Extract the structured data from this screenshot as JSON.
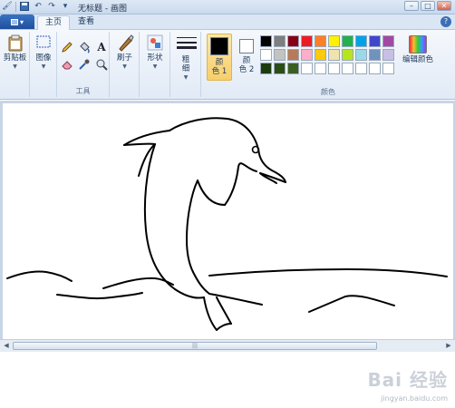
{
  "window": {
    "title": "无标题 - 画图",
    "controls": [
      "minimize-icon",
      "maximize-icon",
      "close-icon"
    ]
  },
  "qat": [
    "save-icon",
    "undo-icon",
    "redo-icon",
    "dropdown-icon"
  ],
  "tabs": [
    {
      "label": "主页",
      "active": true
    },
    {
      "label": "查看",
      "active": false
    }
  ],
  "ribbon": {
    "clipboard": {
      "label": "剪贴板"
    },
    "image": {
      "label": "图像"
    },
    "tools": {
      "group_label": "工具",
      "items": [
        "pencil-icon",
        "fill-icon",
        "text-icon",
        "eraser-icon",
        "color-picker-icon",
        "magnifier-icon"
      ],
      "text_glyph": "A"
    },
    "brushes": {
      "label": "刷子"
    },
    "shapes": {
      "label": "形状"
    },
    "size": {
      "label_line1": "粗",
      "label_line2": "细"
    },
    "color1": {
      "label_line1": "颜",
      "label_line2": "色 1",
      "value": "#000000"
    },
    "color2": {
      "label_line1": "颜",
      "label_line2": "色 2",
      "value": "#ffffff"
    },
    "colors_group_label": "颜色",
    "edit_colors": {
      "label": "编辑颜色"
    },
    "palette": [
      "#000000",
      "#7f7f7f",
      "#880015",
      "#ed1c24",
      "#ff7f27",
      "#fff200",
      "#22b14c",
      "#00a2e8",
      "#3f48cc",
      "#a349a4",
      "#ffffff",
      "#c3c3c3",
      "#b97a57",
      "#ffaec9",
      "#ffc90e",
      "#efe4b0",
      "#b5e61d",
      "#99d9ea",
      "#7092be",
      "#c8bfe7",
      "#1d3b0f",
      "#2a4d17",
      "#3d5e22",
      "#ffffff",
      "#ffffff",
      "#ffffff",
      "#ffffff",
      "#ffffff",
      "#ffffff",
      "#ffffff"
    ]
  },
  "canvas": {
    "drawing": "dolphin sketch"
  },
  "scrollbar": {
    "thumb_grip": "|||"
  },
  "watermark": {
    "text": "Bai 经验",
    "sub": "jingyan.baidu.com"
  }
}
